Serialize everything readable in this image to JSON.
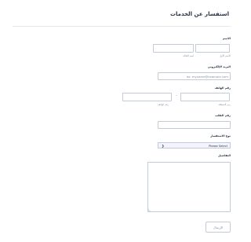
{
  "form": {
    "title": "استفسار عن الخدمات",
    "name": {
      "label": "الاسم",
      "first_sub": "الاسم الأول",
      "last_sub": "اسم العائلة",
      "first_value": "",
      "last_value": ""
    },
    "email": {
      "label": "البريد الإلكتروني",
      "placeholder": "ex: myname@example.com",
      "value": ""
    },
    "phone": {
      "label": "رقم الهاتف",
      "area_sub": "رمز المنطقة",
      "number_sub": "رقم الهاتف",
      "separator": "-",
      "area_value": "",
      "number_value": ""
    },
    "order": {
      "label": "رقم الطلب",
      "value": ""
    },
    "inquiry_type": {
      "label": "نوع الاستفسار",
      "selected": "Please Select"
    },
    "details": {
      "label": "التفاصيل",
      "value": ""
    },
    "submit_label": "الإرسال"
  }
}
